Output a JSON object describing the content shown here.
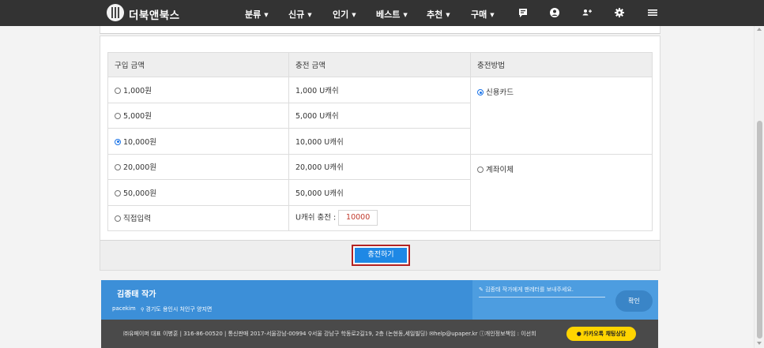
{
  "nav": {
    "brand": "더북앤북스",
    "items": [
      {
        "label": "분류"
      },
      {
        "label": "신규"
      },
      {
        "label": "인기"
      },
      {
        "label": "베스트"
      },
      {
        "label": "추천"
      },
      {
        "label": "구매"
      }
    ],
    "icons": [
      "chat-icon",
      "user-icon",
      "users-icon",
      "gear-icon",
      "menu-icon"
    ]
  },
  "table": {
    "headers": [
      "구입 금액",
      "충전 금액",
      "충전방법"
    ],
    "rows": [
      {
        "amount": "1,000원",
        "charge": "1,000 U캐쉬",
        "selected": false
      },
      {
        "amount": "5,000원",
        "charge": "5,000 U캐쉬",
        "selected": false
      },
      {
        "amount": "10,000원",
        "charge": "10,000 U캐쉬",
        "selected": true
      },
      {
        "amount": "20,000원",
        "charge": "20,000 U캐쉬",
        "selected": false
      },
      {
        "amount": "50,000원",
        "charge": "50,000 U캐쉬",
        "selected": false
      },
      {
        "amount": "직접입력",
        "charge": "U캐쉬 충전 :",
        "selected": false
      }
    ],
    "direct_value": "10000",
    "methods": [
      {
        "label": "신용카드",
        "selected": true
      },
      {
        "label": "계좌이체",
        "selected": false
      }
    ]
  },
  "charge_button": "충전하기",
  "author": {
    "name": "김종태 작가",
    "id": "pacekim",
    "location": "경기도 용인시 처인구 양지면",
    "message_placeholder": "김종태 작가에게 팬레터를 보내주세요.",
    "confirm": "확인"
  },
  "footer": {
    "info": "㈜유페이퍼 대표 이병훈 | 316-86-00520 | 통신판매 2017-서울강남-00994",
    "address": "서울 강남구 학동로2길19, 2층 (논현동,세일빌딩)",
    "email": "help@upaper.kr",
    "privacy": "개인정보책임 : 이선희",
    "kakao": "카카오톡 채팅상담"
  },
  "colors": {
    "nav_bg": "#333333",
    "accent_blue": "#1e88e5",
    "highlight_red": "#b22222",
    "kakao_yellow": "#ffd400"
  }
}
